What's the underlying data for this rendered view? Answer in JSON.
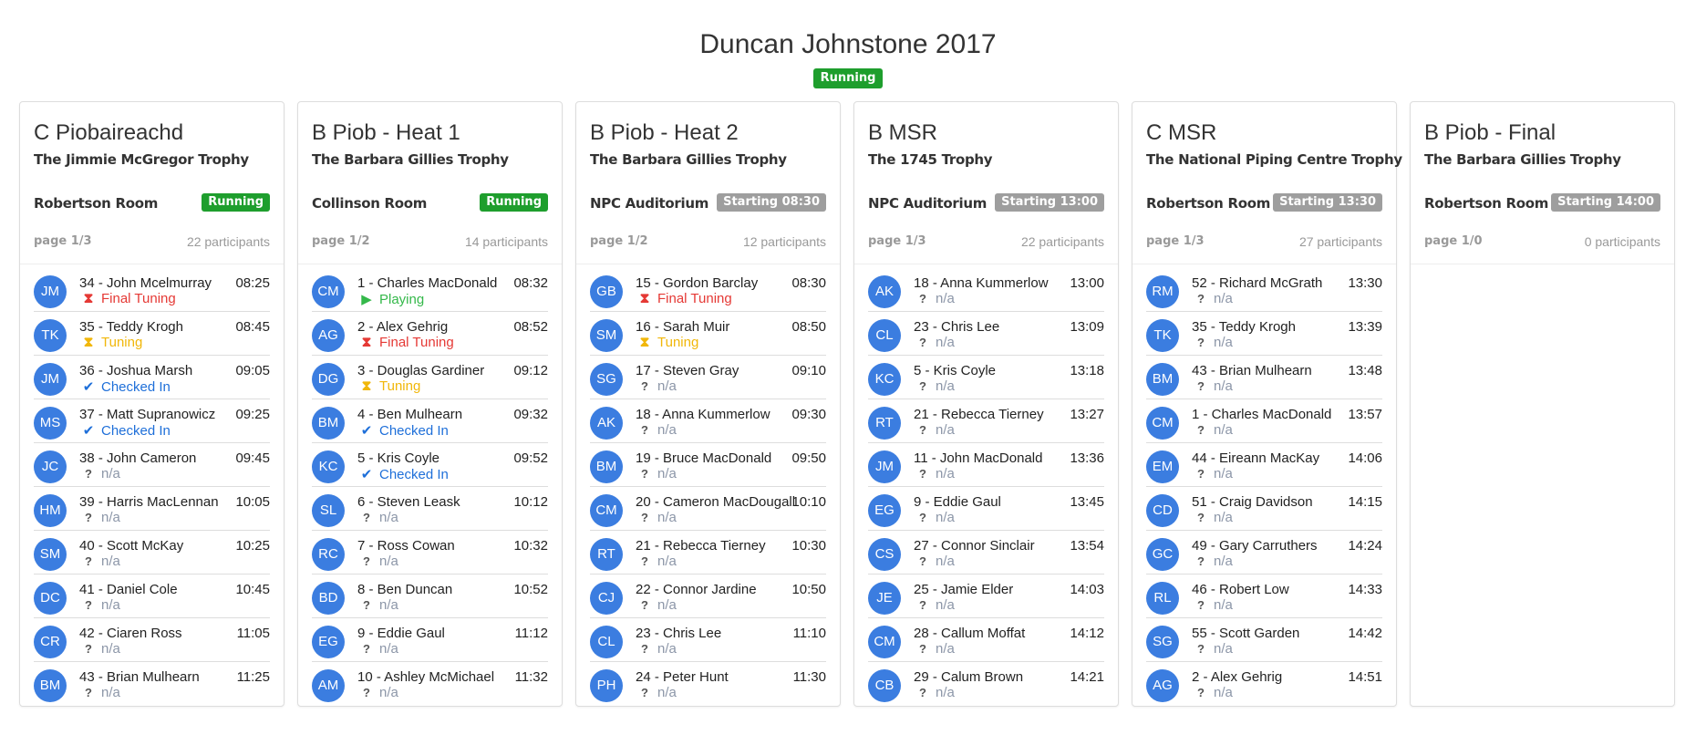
{
  "event": {
    "title": "Duncan Johnstone 2017",
    "status": "Running"
  },
  "colors": {
    "running": "#1e9e2d",
    "starting": "#9e9e9e",
    "avatar": "#3b7de0",
    "final_tuning": "#e53935",
    "tuning": "#f1b70a",
    "checked_in": "#1e6fd9",
    "playing": "#34b84a",
    "na": "#8c96a8"
  },
  "competitions": [
    {
      "title": "C Piobaireachd",
      "trophy": "The Jimmie McGregor Trophy",
      "room": "Robertson Room",
      "badge": "Running",
      "badge_type": "running",
      "page": "page 1/3",
      "participants": "22 participants",
      "rows": [
        {
          "initials": "JM",
          "name": "34 - John Mcelmurray",
          "time": "08:25",
          "status": "Final Tuning",
          "status_type": "final",
          "icon": "hourglass-icon"
        },
        {
          "initials": "TK",
          "name": "35 - Teddy Krogh",
          "time": "08:45",
          "status": "Tuning",
          "status_type": "tuning",
          "icon": "hourglass-icon"
        },
        {
          "initials": "JM",
          "name": "36 - Joshua Marsh",
          "time": "09:05",
          "status": "Checked In",
          "status_type": "checked",
          "icon": "check-icon"
        },
        {
          "initials": "MS",
          "name": "37 - Matt Supranowicz",
          "time": "09:25",
          "status": "Checked In",
          "status_type": "checked",
          "icon": "check-icon"
        },
        {
          "initials": "JC",
          "name": "38 - John Cameron",
          "time": "09:45",
          "status": "n/a",
          "status_type": "na",
          "icon": "question-icon"
        },
        {
          "initials": "HM",
          "name": "39 - Harris MacLennan",
          "time": "10:05",
          "status": "n/a",
          "status_type": "na",
          "icon": "question-icon"
        },
        {
          "initials": "SM",
          "name": "40 - Scott McKay",
          "time": "10:25",
          "status": "n/a",
          "status_type": "na",
          "icon": "question-icon"
        },
        {
          "initials": "DC",
          "name": "41 - Daniel Cole",
          "time": "10:45",
          "status": "n/a",
          "status_type": "na",
          "icon": "question-icon"
        },
        {
          "initials": "CR",
          "name": "42 - Ciaren Ross",
          "time": "11:05",
          "status": "n/a",
          "status_type": "na",
          "icon": "question-icon"
        },
        {
          "initials": "BM",
          "name": "43 - Brian Mulhearn",
          "time": "11:25",
          "status": "n/a",
          "status_type": "na",
          "icon": "question-icon"
        }
      ]
    },
    {
      "title": "B Piob - Heat 1",
      "trophy": "The Barbara Gillies Trophy",
      "room": "Collinson Room",
      "badge": "Running",
      "badge_type": "running",
      "page": "page 1/2",
      "participants": "14 participants",
      "rows": [
        {
          "initials": "CM",
          "name": "1 - Charles MacDonald",
          "time": "08:32",
          "status": "Playing",
          "status_type": "playing",
          "icon": "play-icon"
        },
        {
          "initials": "AG",
          "name": "2 - Alex Gehrig",
          "time": "08:52",
          "status": "Final Tuning",
          "status_type": "final",
          "icon": "hourglass-icon"
        },
        {
          "initials": "DG",
          "name": "3 - Douglas Gardiner",
          "time": "09:12",
          "status": "Tuning",
          "status_type": "tuning",
          "icon": "hourglass-icon"
        },
        {
          "initials": "BM",
          "name": "4 - Ben Mulhearn",
          "time": "09:32",
          "status": "Checked In",
          "status_type": "checked",
          "icon": "check-icon"
        },
        {
          "initials": "KC",
          "name": "5 - Kris Coyle",
          "time": "09:52",
          "status": "Checked In",
          "status_type": "checked",
          "icon": "check-icon"
        },
        {
          "initials": "SL",
          "name": "6 - Steven Leask",
          "time": "10:12",
          "status": "n/a",
          "status_type": "na",
          "icon": "question-icon"
        },
        {
          "initials": "RC",
          "name": "7 - Ross Cowan",
          "time": "10:32",
          "status": "n/a",
          "status_type": "na",
          "icon": "question-icon"
        },
        {
          "initials": "BD",
          "name": "8 - Ben Duncan",
          "time": "10:52",
          "status": "n/a",
          "status_type": "na",
          "icon": "question-icon"
        },
        {
          "initials": "EG",
          "name": "9 - Eddie Gaul",
          "time": "11:12",
          "status": "n/a",
          "status_type": "na",
          "icon": "question-icon"
        },
        {
          "initials": "AM",
          "name": "10 - Ashley McMichael",
          "time": "11:32",
          "status": "n/a",
          "status_type": "na",
          "icon": "question-icon"
        }
      ]
    },
    {
      "title": "B Piob - Heat 2",
      "trophy": "The Barbara Gillies Trophy",
      "room": "NPC Auditorium",
      "badge": "Starting 08:30",
      "badge_type": "starting",
      "page": "page 1/2",
      "participants": "12 participants",
      "rows": [
        {
          "initials": "GB",
          "name": "15 - Gordon Barclay",
          "time": "08:30",
          "status": "Final Tuning",
          "status_type": "final",
          "icon": "hourglass-icon"
        },
        {
          "initials": "SM",
          "name": "16 - Sarah Muir",
          "time": "08:50",
          "status": "Tuning",
          "status_type": "tuning",
          "icon": "hourglass-icon"
        },
        {
          "initials": "SG",
          "name": "17 - Steven Gray",
          "time": "09:10",
          "status": "n/a",
          "status_type": "na",
          "icon": "question-icon"
        },
        {
          "initials": "AK",
          "name": "18 - Anna Kummerlow",
          "time": "09:30",
          "status": "n/a",
          "status_type": "na",
          "icon": "question-icon"
        },
        {
          "initials": "BM",
          "name": "19 - Bruce MacDonald",
          "time": "09:50",
          "status": "n/a",
          "status_type": "na",
          "icon": "question-icon"
        },
        {
          "initials": "CM",
          "name": "20 - Cameron MacDougall",
          "time": "10:10",
          "status": "n/a",
          "status_type": "na",
          "icon": "question-icon"
        },
        {
          "initials": "RT",
          "name": "21 - Rebecca Tierney",
          "time": "10:30",
          "status": "n/a",
          "status_type": "na",
          "icon": "question-icon"
        },
        {
          "initials": "CJ",
          "name": "22 - Connor Jardine",
          "time": "10:50",
          "status": "n/a",
          "status_type": "na",
          "icon": "question-icon"
        },
        {
          "initials": "CL",
          "name": "23 - Chris Lee",
          "time": "11:10",
          "status": "n/a",
          "status_type": "na",
          "icon": "question-icon"
        },
        {
          "initials": "PH",
          "name": "24 - Peter Hunt",
          "time": "11:30",
          "status": "n/a",
          "status_type": "na",
          "icon": "question-icon"
        }
      ]
    },
    {
      "title": "B MSR",
      "trophy": "The 1745 Trophy",
      "room": "NPC Auditorium",
      "badge": "Starting 13:00",
      "badge_type": "starting",
      "page": "page 1/3",
      "participants": "22 participants",
      "rows": [
        {
          "initials": "AK",
          "name": "18 - Anna Kummerlow",
          "time": "13:00",
          "status": "n/a",
          "status_type": "na",
          "icon": "question-icon"
        },
        {
          "initials": "CL",
          "name": "23 - Chris Lee",
          "time": "13:09",
          "status": "n/a",
          "status_type": "na",
          "icon": "question-icon"
        },
        {
          "initials": "KC",
          "name": "5 - Kris Coyle",
          "time": "13:18",
          "status": "n/a",
          "status_type": "na",
          "icon": "question-icon"
        },
        {
          "initials": "RT",
          "name": "21 - Rebecca Tierney",
          "time": "13:27",
          "status": "n/a",
          "status_type": "na",
          "icon": "question-icon"
        },
        {
          "initials": "JM",
          "name": "11 - John MacDonald",
          "time": "13:36",
          "status": "n/a",
          "status_type": "na",
          "icon": "question-icon"
        },
        {
          "initials": "EG",
          "name": "9 - Eddie Gaul",
          "time": "13:45",
          "status": "n/a",
          "status_type": "na",
          "icon": "question-icon"
        },
        {
          "initials": "CS",
          "name": "27 - Connor Sinclair",
          "time": "13:54",
          "status": "n/a",
          "status_type": "na",
          "icon": "question-icon"
        },
        {
          "initials": "JE",
          "name": "25 - Jamie Elder",
          "time": "14:03",
          "status": "n/a",
          "status_type": "na",
          "icon": "question-icon"
        },
        {
          "initials": "CM",
          "name": "28 - Callum Moffat",
          "time": "14:12",
          "status": "n/a",
          "status_type": "na",
          "icon": "question-icon"
        },
        {
          "initials": "CB",
          "name": "29 - Calum Brown",
          "time": "14:21",
          "status": "n/a",
          "status_type": "na",
          "icon": "question-icon"
        }
      ]
    },
    {
      "title": "C MSR",
      "trophy": "The National Piping Centre Trophy",
      "room": "Robertson Room",
      "badge": "Starting 13:30",
      "badge_type": "starting",
      "page": "page 1/3",
      "participants": "27 participants",
      "rows": [
        {
          "initials": "RM",
          "name": "52 - Richard McGrath",
          "time": "13:30",
          "status": "n/a",
          "status_type": "na",
          "icon": "question-icon"
        },
        {
          "initials": "TK",
          "name": "35 - Teddy Krogh",
          "time": "13:39",
          "status": "n/a",
          "status_type": "na",
          "icon": "question-icon"
        },
        {
          "initials": "BM",
          "name": "43 - Brian Mulhearn",
          "time": "13:48",
          "status": "n/a",
          "status_type": "na",
          "icon": "question-icon"
        },
        {
          "initials": "CM",
          "name": "1 - Charles MacDonald",
          "time": "13:57",
          "status": "n/a",
          "status_type": "na",
          "icon": "question-icon"
        },
        {
          "initials": "EM",
          "name": "44 - Eireann MacKay",
          "time": "14:06",
          "status": "n/a",
          "status_type": "na",
          "icon": "question-icon"
        },
        {
          "initials": "CD",
          "name": "51 - Craig Davidson",
          "time": "14:15",
          "status": "n/a",
          "status_type": "na",
          "icon": "question-icon"
        },
        {
          "initials": "GC",
          "name": "49 - Gary Carruthers",
          "time": "14:24",
          "status": "n/a",
          "status_type": "na",
          "icon": "question-icon"
        },
        {
          "initials": "RL",
          "name": "46 - Robert Low",
          "time": "14:33",
          "status": "n/a",
          "status_type": "na",
          "icon": "question-icon"
        },
        {
          "initials": "SG",
          "name": "55 - Scott Garden",
          "time": "14:42",
          "status": "n/a",
          "status_type": "na",
          "icon": "question-icon"
        },
        {
          "initials": "AG",
          "name": "2 - Alex Gehrig",
          "time": "14:51",
          "status": "n/a",
          "status_type": "na",
          "icon": "question-icon"
        }
      ]
    },
    {
      "title": "B Piob - Final",
      "trophy": "The Barbara Gillies Trophy",
      "room": "Robertson Room",
      "badge": "Starting 14:00",
      "badge_type": "starting",
      "page": "page 1/0",
      "participants": "0 participants",
      "rows": []
    }
  ]
}
